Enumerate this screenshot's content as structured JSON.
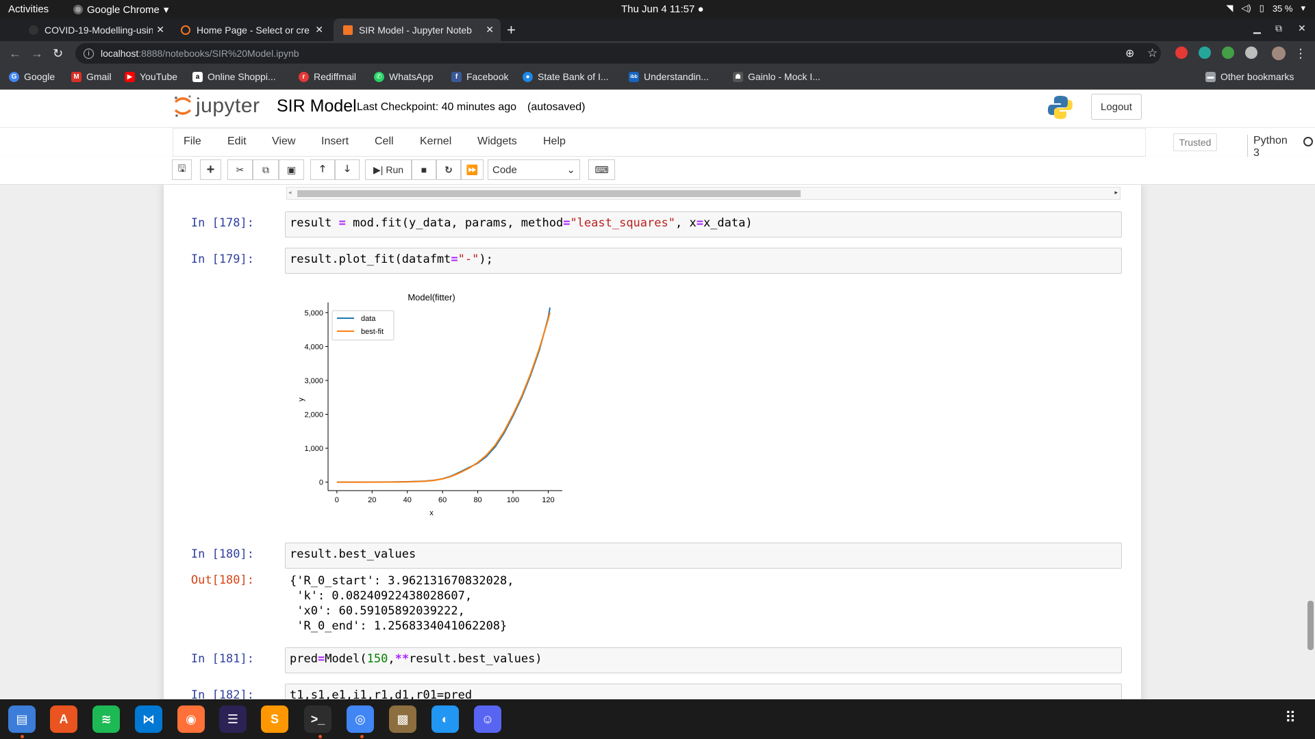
{
  "system": {
    "activities": "Activities",
    "app_name": "Google Chrome",
    "clock": "Thu Jun 4  11:57 ●",
    "battery": "35 %"
  },
  "tabs": [
    {
      "title": "COVID-19-Modelling-usin",
      "active": false
    },
    {
      "title": "Home Page - Select or cre",
      "active": false
    },
    {
      "title": "SIR Model - Jupyter Noteb",
      "active": true
    }
  ],
  "address": {
    "host": "localhost",
    "path": ":8888/notebooks/SIR%20Model.ipynb"
  },
  "bookmarks": [
    {
      "label": "Google",
      "color": "#4285f4",
      "glyph": "G"
    },
    {
      "label": "Gmail",
      "color": "#d93025",
      "glyph": "M"
    },
    {
      "label": "YouTube",
      "color": "#ff0000",
      "glyph": "▶"
    },
    {
      "label": "Online Shoppi...",
      "color": "#ffffff",
      "glyph": "a"
    },
    {
      "label": "Rediffmail",
      "color": "#e53935",
      "glyph": "r"
    },
    {
      "label": "WhatsApp",
      "color": "#25d366",
      "glyph": "✆"
    },
    {
      "label": "Facebook",
      "color": "#3b5998",
      "glyph": "f"
    },
    {
      "label": "State Bank of I...",
      "color": "#1e88e5",
      "glyph": "●"
    },
    {
      "label": "Understandin...",
      "color": "#1565c0",
      "glyph": "ibb"
    },
    {
      "label": "Gainlo - Mock I...",
      "color": "#555555",
      "glyph": "☗"
    }
  ],
  "other_bookmarks": "Other bookmarks",
  "jupyter": {
    "logo_text": "jupyter",
    "notebook_name": "SIR Model",
    "checkpoint": "Last Checkpoint: 40 minutes ago",
    "autosaved": "(autosaved)",
    "logout": "Logout",
    "menu": [
      "File",
      "Edit",
      "View",
      "Insert",
      "Cell",
      "Kernel",
      "Widgets",
      "Help"
    ],
    "trusted": "Trusted",
    "kernel": "Python 3",
    "run_label": "Run",
    "cell_type": "Code"
  },
  "cells": {
    "c178": {
      "prompt": "In [178]:"
    },
    "c179": {
      "prompt": "In [179]:"
    },
    "c180": {
      "prompt": "In [180]:",
      "code": "result.best_values",
      "out_prompt": "Out[180]:",
      "output": "{'R_0_start': 3.962131670832028,\n 'k': 0.08240922438028607,\n 'x0': 60.59105892039222,\n 'R_0_end': 1.2568334041062208}"
    },
    "c181": {
      "prompt": "In [181]:"
    },
    "c182": {
      "prompt": "In [182]:",
      "code": "t1,s1,e1,i1,r1,d1,r01=pred"
    }
  },
  "chart_data": {
    "type": "line",
    "title": "Model(fitter)",
    "xlabel": "x",
    "ylabel": "y",
    "xlim": [
      -5,
      128
    ],
    "ylim": [
      -250,
      5300
    ],
    "xticks": [
      0,
      20,
      40,
      60,
      80,
      100,
      120
    ],
    "yticks": [
      0,
      1000,
      2000,
      3000,
      4000,
      5000
    ],
    "ytick_labels": [
      "0",
      "1,000",
      "2,000",
      "3,000",
      "4,000",
      "5,000"
    ],
    "legend_position": "top-left",
    "series": [
      {
        "name": "data",
        "color": "#1f77b4",
        "x": [
          0,
          10,
          20,
          30,
          40,
          50,
          55,
          60,
          65,
          70,
          75,
          80,
          85,
          90,
          95,
          100,
          105,
          110,
          115,
          120,
          121
        ],
        "y": [
          0,
          0,
          2,
          5,
          12,
          30,
          55,
          100,
          180,
          300,
          430,
          560,
          760,
          1050,
          1450,
          1950,
          2500,
          3150,
          3900,
          4850,
          5150
        ]
      },
      {
        "name": "best-fit",
        "color": "#ff7f0e",
        "x": [
          0,
          10,
          20,
          30,
          40,
          50,
          55,
          60,
          65,
          70,
          75,
          80,
          85,
          90,
          95,
          100,
          105,
          110,
          115,
          120,
          121
        ],
        "y": [
          0,
          0,
          1,
          3,
          8,
          25,
          50,
          95,
          170,
          280,
          410,
          580,
          800,
          1100,
          1500,
          2000,
          2550,
          3200,
          3950,
          4800,
          5000
        ]
      }
    ]
  },
  "dock": [
    {
      "name": "files",
      "color": "#3b7dd8",
      "glyph": "▤"
    },
    {
      "name": "software",
      "color": "#e95420",
      "glyph": "A"
    },
    {
      "name": "spotify",
      "color": "#1db954",
      "glyph": "≋"
    },
    {
      "name": "vscode",
      "color": "#0078d4",
      "glyph": "⋈"
    },
    {
      "name": "firefox",
      "color": "#ff7139",
      "glyph": "◉"
    },
    {
      "name": "eclipse",
      "color": "#2c2255",
      "glyph": "☰"
    },
    {
      "name": "sublime",
      "color": "#ff9800",
      "glyph": "S"
    },
    {
      "name": "terminal",
      "color": "#2d2d2d",
      "glyph": ">_"
    },
    {
      "name": "chrome",
      "color": "#4285f4",
      "glyph": "◎"
    },
    {
      "name": "dosbox",
      "color": "#8d6e3f",
      "glyph": "▩"
    },
    {
      "name": "ubuntu-sync",
      "color": "#2196f3",
      "glyph": "◐"
    },
    {
      "name": "discord",
      "color": "#5865f2",
      "glyph": "☺"
    }
  ]
}
